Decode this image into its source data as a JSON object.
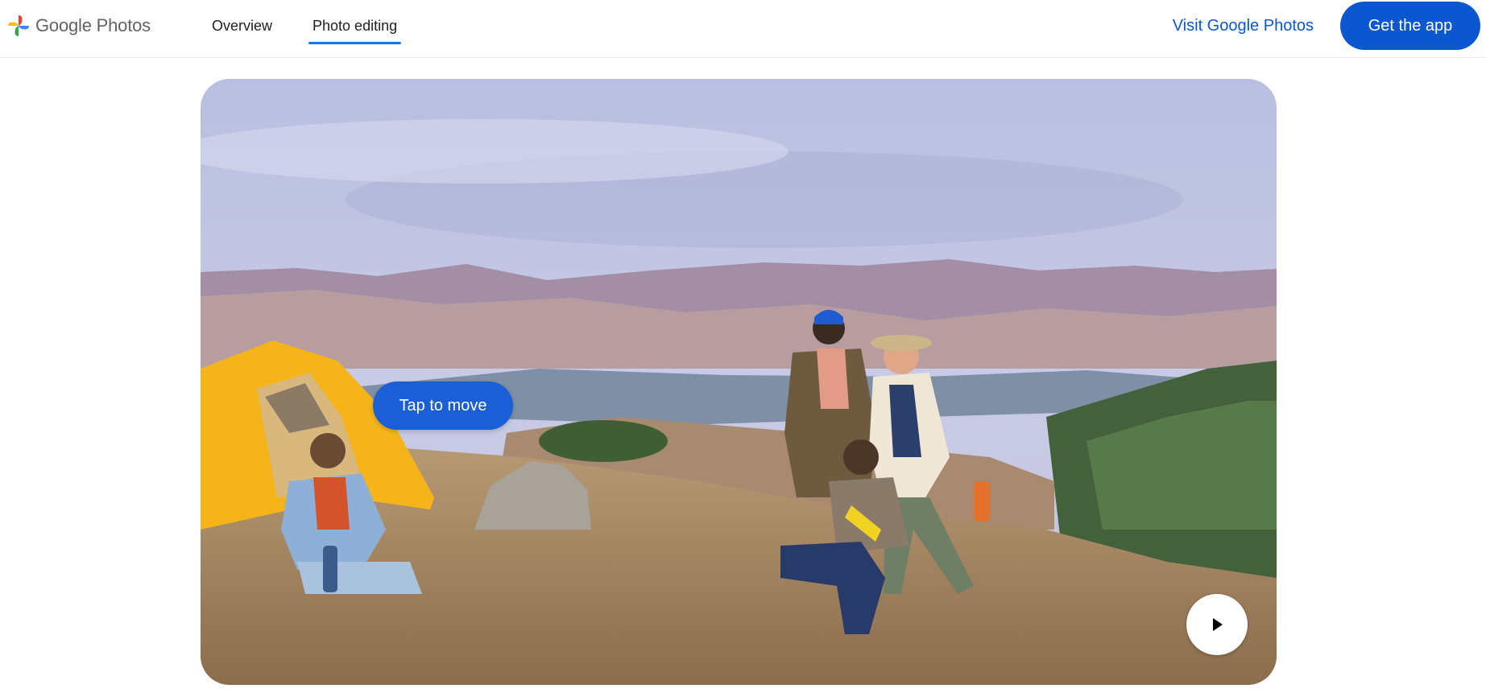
{
  "header": {
    "logo_text": "Google Photos",
    "nav": [
      {
        "label": "Overview",
        "active": false
      },
      {
        "label": "Photo editing",
        "active": true
      }
    ],
    "visit_link": "Visit Google Photos",
    "cta_label": "Get the app"
  },
  "hero": {
    "tap_label": "Tap to move",
    "play_icon": "play-icon"
  },
  "colors": {
    "accent": "#0b57d0",
    "tab_underline": "#1a73e8",
    "tap_button": "#1a5fd6"
  }
}
